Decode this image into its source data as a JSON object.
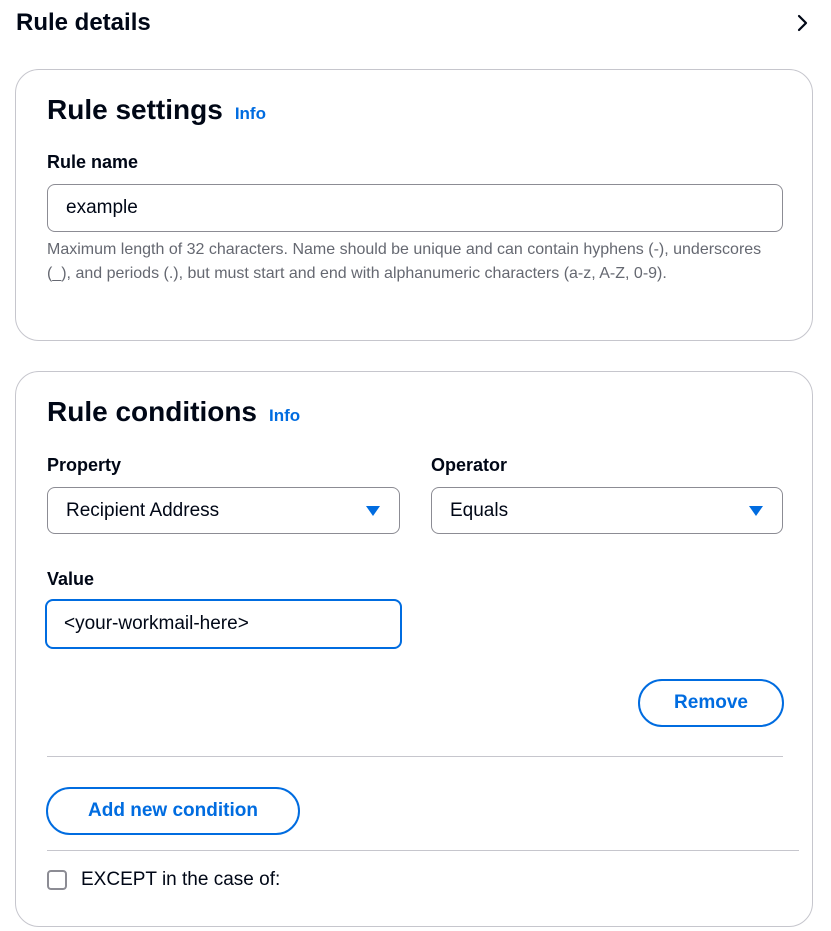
{
  "page": {
    "title": "Rule details"
  },
  "rule_settings": {
    "title": "Rule settings",
    "info_label": "Info",
    "rule_name": {
      "label": "Rule name",
      "value": "example",
      "hint": "Maximum length of 32 characters. Name should be unique and can contain hyphens (-), underscores (_), and periods (.), but must start and end with alphanumeric characters (a-z, A-Z, 0-9)."
    }
  },
  "rule_conditions": {
    "title": "Rule conditions",
    "info_label": "Info",
    "property": {
      "label": "Property",
      "selected": "Recipient Address"
    },
    "operator": {
      "label": "Operator",
      "selected": "Equals"
    },
    "value": {
      "label": "Value",
      "value": "<your-workmail-here>"
    },
    "remove_label": "Remove",
    "add_condition_label": "Add new condition",
    "except": {
      "label": "EXCEPT in the case of:",
      "checked": false
    }
  },
  "colors": {
    "accent": "#006ce0",
    "text": "#000716",
    "hint": "#656871",
    "border": "#c6c6cd"
  },
  "icons": {
    "header_chevron": "chevron-right-icon",
    "select_caret": "caret-down-icon"
  }
}
